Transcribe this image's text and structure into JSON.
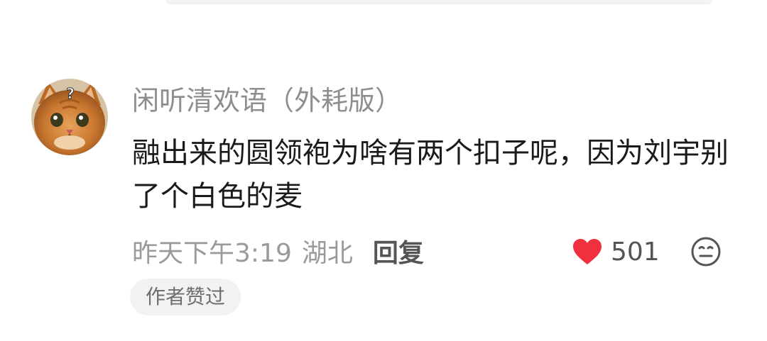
{
  "comment": {
    "username": "闲听清欢语（外耗版）",
    "content": "融出来的圆领袍为啥有两个扣子呢，因为刘宇别了个白色的麦",
    "time": "昨天下午3:19",
    "location": "湖北",
    "reply_label": "回复",
    "like_count": "501",
    "author_badge": "作者赞过",
    "like_color": "#f0303f"
  },
  "icons": {
    "like": "heart-icon",
    "emoji": "emoji-face-icon"
  }
}
